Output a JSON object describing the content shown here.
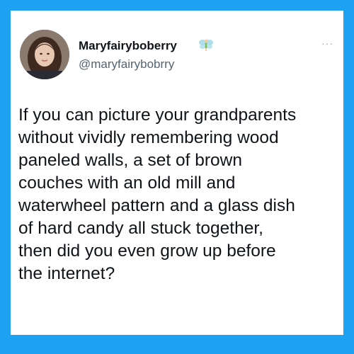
{
  "tweet": {
    "author": {
      "display_name": "Maryfairyboberry",
      "handle": "@maryfairybobrry",
      "badge_icon": "fairy-emoji-icon",
      "avatar_icon": "profile-photo"
    },
    "more_label": "···",
    "text": "If you can picture your grandparents\nwithout vividly remembering wood\npaneled walls, a set of brown\ncouches with an old mill and\nwaterwheel pattern and a glass dish\nof hard candy all stuck together,\nthen did you even grow up before\nthe internet?"
  },
  "colors": {
    "background": "#1da1f2",
    "card": "#ffffff",
    "text": "#0f1419",
    "secondary_text": "#536471"
  }
}
